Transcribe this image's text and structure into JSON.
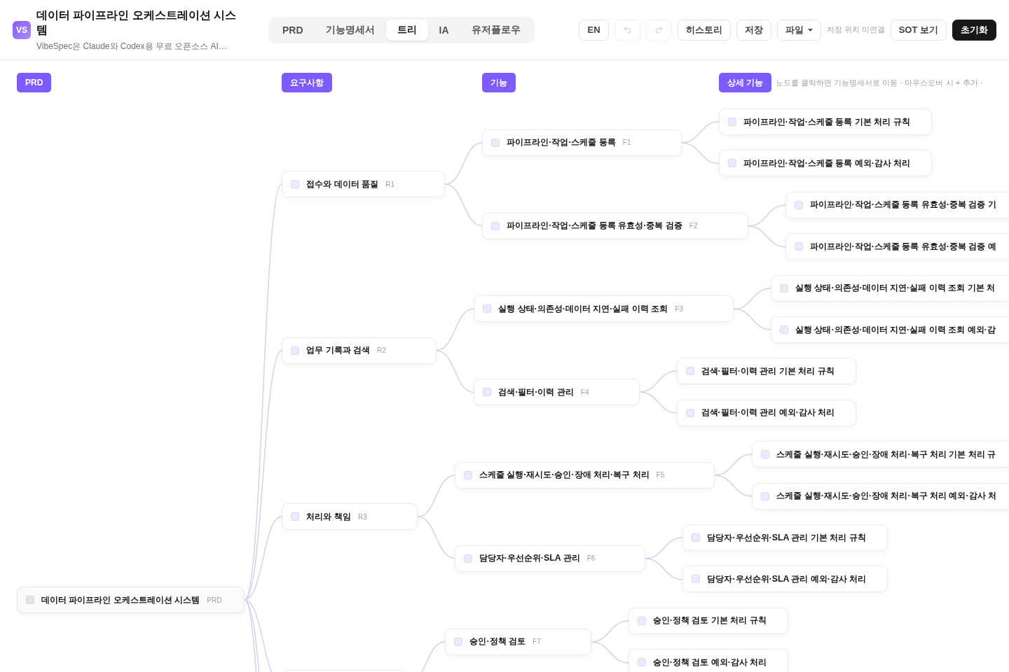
{
  "header": {
    "logo": "VS",
    "title": "데이터 파이프라인 오케스트레이션 시스템",
    "subtitle": "VibeSpec은 Claude와 Codex용 무료 오픈소스 AI…"
  },
  "tabs": [
    {
      "label": "PRD",
      "selected": false
    },
    {
      "label": "기능명세서",
      "selected": false
    },
    {
      "label": "트리",
      "selected": true
    },
    {
      "label": "IA",
      "selected": false
    },
    {
      "label": "유저플로우",
      "selected": false
    }
  ],
  "toolbar_buttons": [
    {
      "kind": "text",
      "label": "EN",
      "disabled": false
    },
    {
      "kind": "undo",
      "disabled": true
    },
    {
      "kind": "redo",
      "disabled": true
    },
    {
      "kind": "text",
      "label": "히스토리",
      "disabled": false
    },
    {
      "kind": "text",
      "label": "저장",
      "disabled": false
    },
    {
      "kind": "menu",
      "label": "파일",
      "disabled": false
    }
  ],
  "save_status": "저장 위치 미연결",
  "end_buttons": [
    {
      "kind": "text",
      "label": "SOT 보기"
    },
    {
      "kind": "primary",
      "label": "초기화"
    }
  ],
  "tree": {
    "columns": [
      {
        "label": "PRD"
      },
      {
        "label": "요구사항"
      },
      {
        "label": "기능"
      },
      {
        "label": "상세 기능"
      }
    ],
    "hint": "노드를 클릭하면 기능명세서로 이동 · 마우스오버 시 + 추가 ·",
    "root": {
      "label": "데이터 파이프라인 오케스트레이션 시스템",
      "tag": "PRD",
      "checked": false,
      "children": [
        {
          "label": "접수와 데이터 품질",
          "tag": "R1",
          "checked": false,
          "children": [
            {
              "label": "파이프라인·작업·스케줄 등록",
              "tag": "F1",
              "checked": false,
              "children": [
                {
                  "label": "파이프라인·작업·스케줄 등록 기본 처리 규칙",
                  "checked": false
                },
                {
                  "label": "파이프라인·작업·스케줄 등록 예외·감사 처리",
                  "checked": false
                }
              ]
            },
            {
              "label": "파이프라인·작업·스케줄 등록 유효성·중복 검증",
              "tag": "F2",
              "checked": false,
              "children": [
                {
                  "label": "파이프라인·작업·스케줄 등록 유효성·중복 검증 기",
                  "checked": false
                },
                {
                  "label": "파이프라인·작업·스케줄 등록 유효성·중복 검증 예",
                  "checked": false
                }
              ]
            }
          ]
        },
        {
          "label": "업무 기록과 검색",
          "tag": "R2",
          "checked": false,
          "children": [
            {
              "label": "실행 상태·의존성·데이터 지연·실패 이력 조회",
              "tag": "F3",
              "checked": false,
              "children": [
                {
                  "label": "실행 상태·의존성·데이터 지연·실패 이력 조회 기본 처",
                  "checked": false
                },
                {
                  "label": "실행 상태·의존성·데이터 지연·실패 이력 조회 예외·감",
                  "checked": false
                }
              ]
            },
            {
              "label": "검색·필터·이력 관리",
              "tag": "F4",
              "checked": false,
              "children": [
                {
                  "label": "검색·필터·이력 관리 기본 처리 규칙",
                  "checked": false
                },
                {
                  "label": "검색·필터·이력 관리 예외·감사 처리",
                  "checked": false
                }
              ]
            }
          ]
        },
        {
          "label": "처리와 책임",
          "tag": "R3",
          "checked": false,
          "children": [
            {
              "label": "스케줄 실행·재시도·승인·장애 처리·복구 처리",
              "tag": "F5",
              "checked": false,
              "children": [
                {
                  "label": "스케줄 실행·재시도·승인·장애 처리·복구 처리 기본 처리 규",
                  "checked": false
                },
                {
                  "label": "스케줄 실행·재시도·승인·장애 처리·복구 처리 예외·감사 처",
                  "checked": false
                }
              ]
            },
            {
              "label": "담당자·우선순위·SLA 관리",
              "tag": "F6",
              "checked": false,
              "children": [
                {
                  "label": "담당자·우선순위·SLA 관리 기본 처리 규칙",
                  "checked": false
                },
                {
                  "label": "담당자·우선순위·SLA 관리 예외·감사 처리",
                  "checked": false
                }
              ]
            }
          ]
        },
        {
          "children": [
            {
              "label": "승인·정책 검토",
              "tag": "F7",
              "checked": false,
              "children": [
                {
                  "label": "승인·정책 검토 기본 처리 규칙",
                  "checked": false
                },
                {
                  "label": "승인·정책 검토 예외·감사 처리",
                  "checked": false
                }
              ]
            }
          ]
        }
      ]
    }
  }
}
